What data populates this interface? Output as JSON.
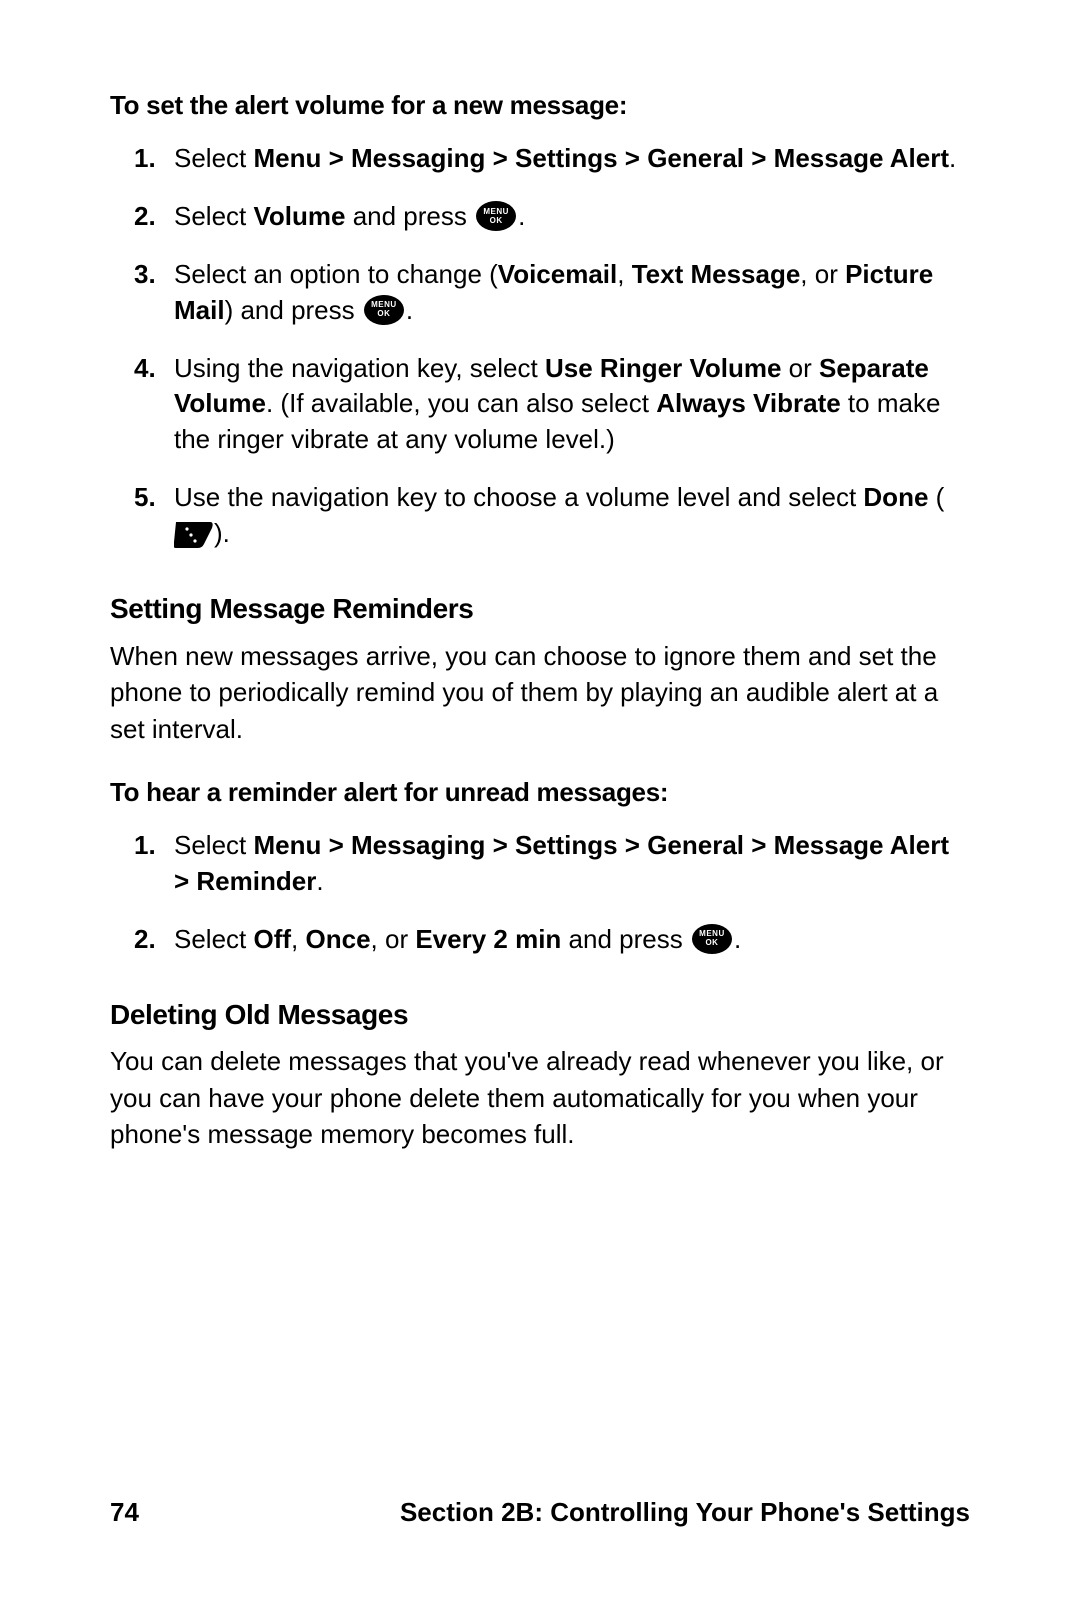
{
  "section1": {
    "intro": "To set the alert volume for a new message:",
    "items": {
      "i1": {
        "pre": "Select ",
        "path": "Menu > Messaging > Settings > General > Message Alert",
        "post": "."
      },
      "i2": {
        "pre": "Select ",
        "b1": "Volume",
        "mid": " and press ",
        "post": "."
      },
      "i3": {
        "pre": "Select an option to change (",
        "b1": "Voicemail",
        "c1": ", ",
        "b2": "Text Message",
        "c2": ", or ",
        "b3": "Picture Mail",
        "mid": ") and press ",
        "post": "."
      },
      "i4": {
        "pre": "Using the navigation key, select ",
        "b1": "Use Ringer Volume",
        "mid1": " or ",
        "b2": "Separate Volume",
        "mid2": ". (If available, you can also select ",
        "b3": "Always Vibrate",
        "post": " to make the ringer vibrate at any volume level.)"
      },
      "i5": {
        "pre": "Use the navigation key to choose a volume level and select ",
        "b1": "Done",
        "mid": " (",
        "post": ")."
      }
    }
  },
  "section2": {
    "heading": "Setting Message Reminders",
    "para": "When new messages arrive, you can choose to ignore them and set the phone to periodically remind you of them by playing an audible alert at a set interval.",
    "intro": "To hear a reminder alert for unread messages:",
    "items": {
      "i1": {
        "pre": "Select ",
        "path": "Menu > Messaging > Settings > General > Message Alert > Reminder",
        "post": "."
      },
      "i2": {
        "pre": "Select ",
        "b1": "Off",
        "c1": ", ",
        "b2": "Once",
        "c2": ", or ",
        "b3": "Every 2 min",
        "mid": " and press ",
        "post": "."
      }
    }
  },
  "section3": {
    "heading": "Deleting Old Messages",
    "para": "You can delete messages that you've already read whenever you like, or you can have your phone delete them automatically for you when your phone's message memory becomes full."
  },
  "footer": {
    "page": "74",
    "title": "Section 2B: Controlling Your Phone's Settings"
  },
  "icons": {
    "menu": "MENU",
    "ok": "OK"
  }
}
